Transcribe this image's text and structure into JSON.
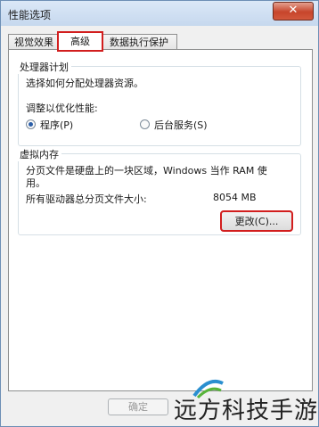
{
  "window": {
    "title": "性能选项"
  },
  "titlebar": {
    "close_icon": "close-x"
  },
  "tabs": [
    {
      "label": "视觉效果"
    },
    {
      "label": "高级"
    },
    {
      "label": "数据执行保护"
    }
  ],
  "processor": {
    "title": "处理器计划",
    "description": "选择如何分配处理器资源。",
    "adjust_label": "调整以优化性能:",
    "options": [
      {
        "label": "程序(P)",
        "selected": true
      },
      {
        "label": "后台服务(S)",
        "selected": false
      }
    ]
  },
  "virtual_memory": {
    "title": "虚拟内存",
    "description_line1": "分页文件是硬盘上的一块区域，Windows 当作 RAM 使",
    "description_line2": "用。",
    "total_label": "所有驱动器总分页文件大小:",
    "total_value": "8054 MB",
    "change_button": "更改(C)..."
  },
  "footer": {
    "ok_button": "确定"
  },
  "watermark": {
    "text": "远方科技手游"
  },
  "highlight_color": "#d21e1e"
}
